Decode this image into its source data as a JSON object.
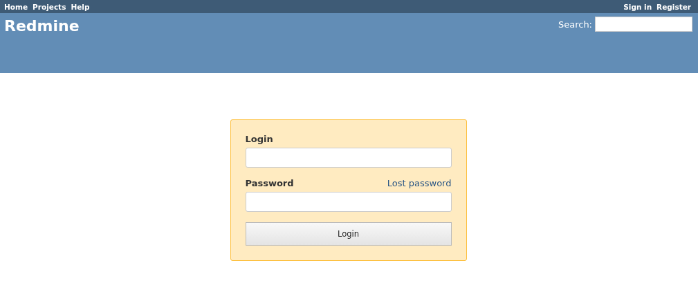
{
  "top_menu": {
    "left": [
      "Home",
      "Projects",
      "Help"
    ],
    "right": [
      "Sign in",
      "Register"
    ]
  },
  "header": {
    "title": "Redmine",
    "search_label": "Search:"
  },
  "login_form": {
    "login_label": "Login",
    "password_label": "Password",
    "lost_password_link": "Lost password",
    "submit_button": "Login"
  }
}
